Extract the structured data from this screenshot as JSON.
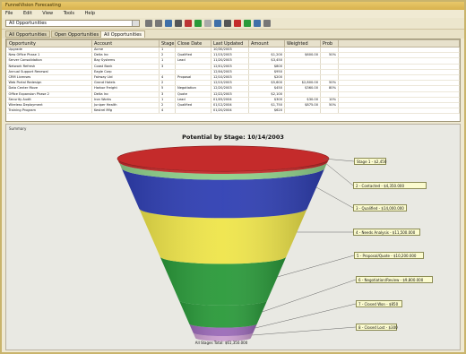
{
  "window": {
    "title": "FunnelVision Forecasting"
  },
  "menu": [
    "File",
    "Edit",
    "View",
    "Tools",
    "Help"
  ],
  "toolbar": {
    "filter_value": "All Opportunities",
    "buttons": [
      "back-icon",
      "forward-icon",
      "save-icon",
      "print-icon",
      "filter-icon",
      "chart-icon",
      "table-icon",
      "refresh-icon",
      "sort-icon",
      "funnel-icon",
      "export-icon",
      "zoom-icon",
      "help-icon"
    ]
  },
  "tabs": [
    "All Opportunities",
    "Open Opportunities",
    "All Opportunities"
  ],
  "active_tab": 2,
  "grid": {
    "columns": [
      "Opportunity",
      "Account",
      "Stage",
      "Close Date",
      "Last Updated",
      "Amount",
      "Weighted",
      "Prob"
    ],
    "rows": [
      [
        "Upgrade",
        "Acme",
        "1",
        "",
        "10/30/2003",
        "",
        "",
        ""
      ],
      [
        "New Office Phase 1",
        "Delta Inc",
        "2",
        "Qualified",
        "11/15/2003",
        "$1,200",
        "$600.00",
        "50%"
      ],
      [
        "Server Consolidation",
        "Bay Systems",
        "1",
        "Lead",
        "11/20/2003",
        "$3,450",
        "",
        ""
      ],
      [
        "Network Refresh",
        "Coast Bank",
        "3",
        "",
        "12/01/2003",
        "$800",
        "",
        ""
      ],
      [
        "Annual Support Renewal",
        "Eagle Corp",
        "",
        "",
        "12/04/2003",
        "$950",
        "",
        ""
      ],
      [
        "CRM Licenses",
        "Fairway Ltd",
        "4",
        "Proposal",
        "12/10/2003",
        "$200",
        "",
        ""
      ],
      [
        "Web Portal Redesign",
        "Grand Hotels",
        "2",
        "",
        "12/15/2003",
        "$5,600",
        "$2,800.00",
        "50%"
      ],
      [
        "Data Center Move",
        "Harbor Freight",
        "5",
        "Negotiation",
        "12/20/2003",
        "$450",
        "$360.00",
        "80%"
      ],
      [
        "Office Expansion Phase 2",
        "Delta Inc",
        "3",
        "Quote",
        "12/22/2003",
        "$2,100",
        "",
        ""
      ],
      [
        "Security Audit",
        "Iron Works",
        "1",
        "Lead",
        "01/05/2004",
        "$300",
        "$30.00",
        "10%"
      ],
      [
        "Wireless Deployment",
        "Juniper Health",
        "2",
        "Qualified",
        "01/12/2004",
        "$1,750",
        "$875.00",
        "50%"
      ],
      [
        "Training Program",
        "Kestrel Mfg",
        "4",
        "",
        "01/20/2004",
        "$620",
        "",
        ""
      ]
    ]
  },
  "funnel": {
    "panel_caption": "Summary",
    "title": "Potential by Stage: 10/14/2003",
    "bottom_label": "All Stages Total: $61,350.000",
    "stages": [
      {
        "label": "Stage 1 - $2,450",
        "color": "#c42b2b"
      },
      {
        "label": "2 - Contacted - $4,350.000",
        "color": "#3a3ab0"
      },
      {
        "label": "3 - Qualified - $14,000.000",
        "color": "#2f3fb3"
      },
      {
        "label": "4 - Needs Analysis - $11,500.000",
        "color": "#efe54a"
      },
      {
        "label": "5 - Proposal/Quote - $10,200.000",
        "color": "#2a9a3a"
      },
      {
        "label": "6 - Negotiation/Review - $9,800.000",
        "color": "#2a9a3a"
      },
      {
        "label": "7 - Closed Won - $850",
        "color": "#9b6ab8"
      },
      {
        "label": "8 - Closed Lost - $300",
        "color": "#cc9fd0"
      }
    ]
  }
}
